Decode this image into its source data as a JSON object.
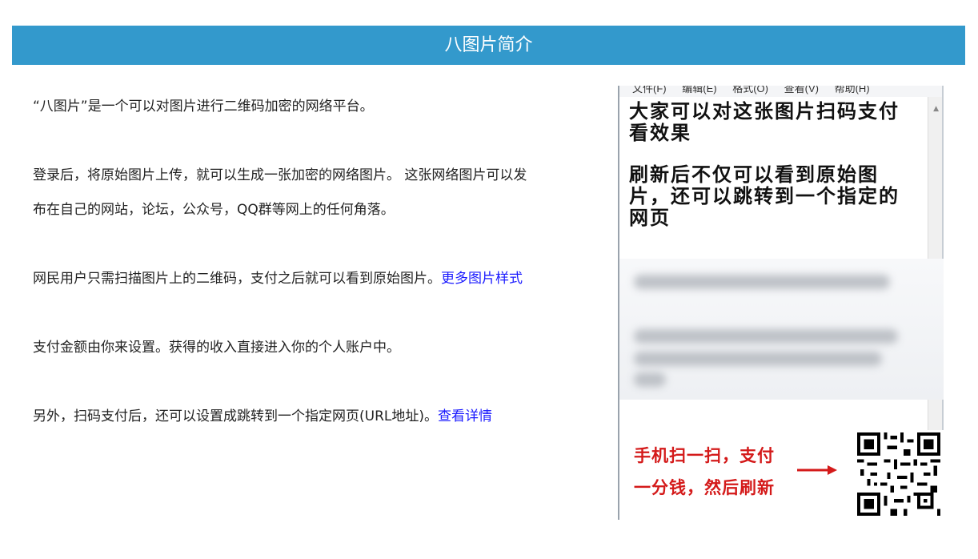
{
  "header": {
    "title": "八图片简介"
  },
  "intro": {
    "p1": "“八图片”是一个可以对图片进行二维码加密的网络平台。",
    "p2_line1": "登录后，将原始图片上传，就可以生成一张加密的网络图片。 这张网络图片可以发",
    "p2_line2": "布在自己的网站，论坛，公众号，QQ群等网上的任何角落。",
    "p3_text": "网民用户只需扫描图片上的二维码，支付之后就可以看到原始图片。",
    "p3_link": "更多图片样式",
    "p4": "支付金额由你来设置。获得的收入直接进入你的个人账户中。",
    "p5_text": "另外，扫码支付后，还可以设置成跳转到一个指定网页(URL地址)。",
    "p5_link": "查看详情"
  },
  "sample_image": {
    "menu": [
      "文件(F)",
      "编辑(E)",
      "格式(O)",
      "查看(V)",
      "帮助(H)"
    ],
    "note_line1": "大家可以对这张图片扫码支付看效果",
    "note_line2": "刷新后不仅可以看到原始图片，还可以跳转到一个指定的网页",
    "pay_line1": "手机扫一扫，支付",
    "pay_line2": "一分钱，然后刷新",
    "icons": {
      "arrow": "arrow-right-icon",
      "qr": "qr-code-icon"
    },
    "colors": {
      "accent": "#3399cc",
      "red": "#d41a1a",
      "link": "#1a1aff"
    }
  }
}
